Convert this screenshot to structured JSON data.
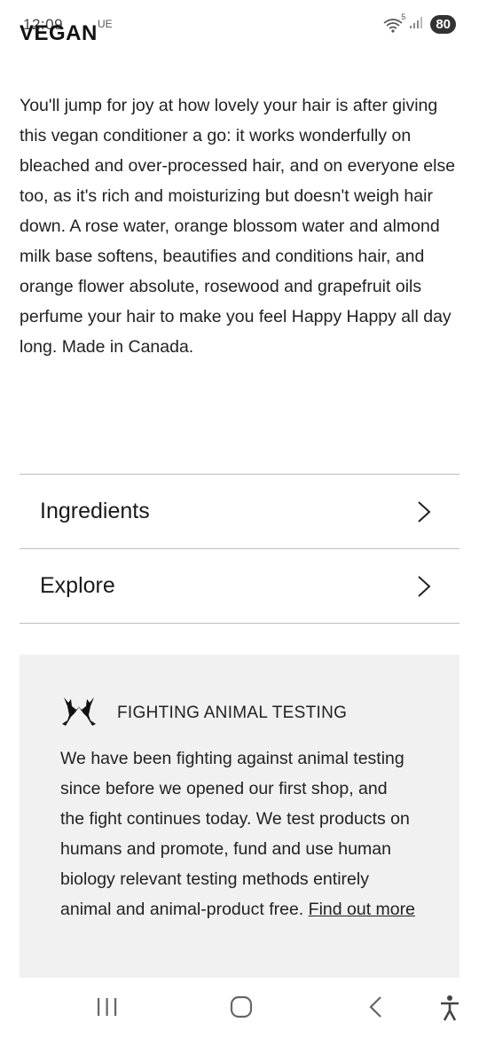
{
  "status_bar": {
    "time": "12:09",
    "network_label": "UE",
    "wifi_label": "5",
    "battery": "80"
  },
  "header": {
    "label": "VEGAN"
  },
  "description": "You'll jump for joy at how lovely your hair is after giving this vegan conditioner a go: it works wonderfully on bleached and over-processed hair, and on everyone else too, as it's rich and moisturizing but doesn't weigh hair down. A rose water, orange blossom water and almond milk base softens, beautifies and conditions hair, and orange flower absolute, rosewood and grapefruit oils perfume your hair to make you feel Happy Happy all day long. Made in Canada.",
  "accordion": {
    "items": [
      {
        "label": "Ingredients",
        "icon": "chevron-right-icon"
      },
      {
        "label": "Explore",
        "icon": "chevron-right-icon"
      }
    ]
  },
  "promo": {
    "icon": "hares-icon",
    "title": "FIGHTING ANIMAL TESTING",
    "text": "We have been fighting against animal testing since before we opened our first shop, and the fight continues today. We test products on humans and promote, fund and use human biology relevant testing methods entirely animal and animal-product free.",
    "link": "Find out more"
  },
  "nav_bar": {
    "recents_icon": "recents-icon",
    "home_icon": "home-icon",
    "back_icon": "back-icon",
    "accessibility_icon": "accessibility-icon"
  }
}
